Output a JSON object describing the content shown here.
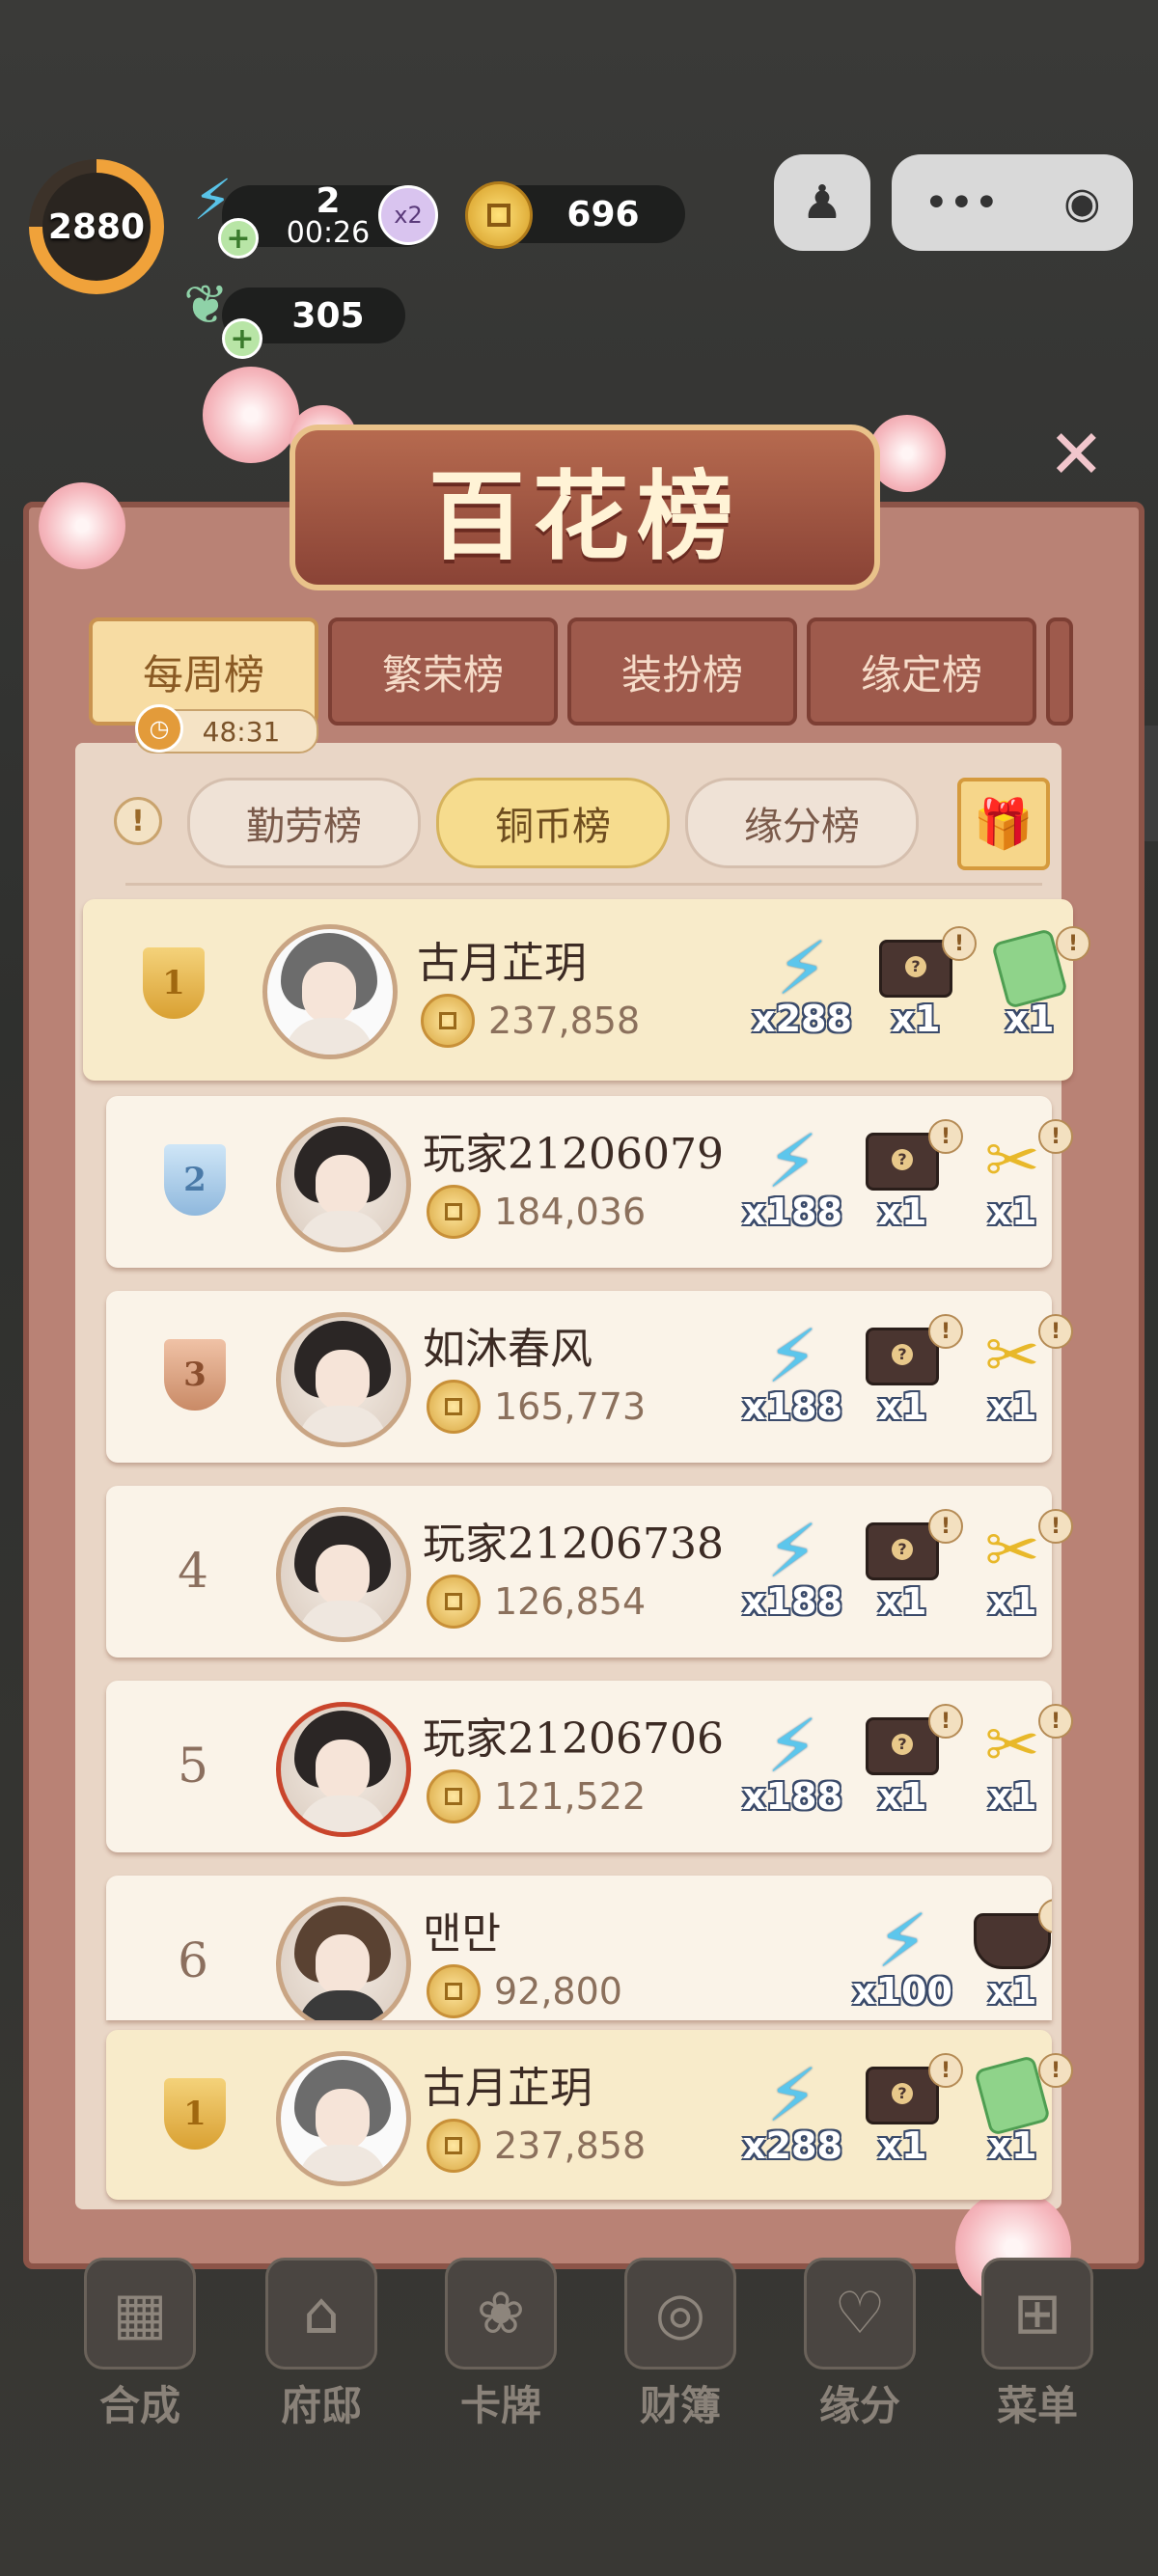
{
  "hud": {
    "level": "2880",
    "energy": "2",
    "energy_timer": "00:26",
    "multiplier": "x2",
    "coins": "696",
    "jade": "305"
  },
  "board": {
    "title": "百花榜",
    "tabs": [
      "每周榜",
      "繁荣榜",
      "装扮榜",
      "缘定榜"
    ],
    "active_tab": "每周榜",
    "tab_timer": "48:31",
    "sub_tabs": [
      "勤劳榜",
      "铜币榜",
      "缘分榜"
    ],
    "active_sub_tab": "铜币榜"
  },
  "rows": [
    {
      "rank": "1",
      "name": "古月芷玥",
      "score": "237,858",
      "r1": "x288",
      "r2": "x1",
      "r3": "x1"
    },
    {
      "rank": "2",
      "name": "玩家21206079",
      "score": "184,036",
      "r1": "x188",
      "r2": "x1",
      "r3": "x1"
    },
    {
      "rank": "3",
      "name": "如沐春风",
      "score": "165,773",
      "r1": "x188",
      "r2": "x1",
      "r3": "x1"
    },
    {
      "rank": "4",
      "name": "玩家21206738",
      "score": "126,854",
      "r1": "x188",
      "r2": "x1",
      "r3": "x1"
    },
    {
      "rank": "5",
      "name": "玩家21206706",
      "score": "121,522",
      "r1": "x188",
      "r2": "x1",
      "r3": "x1"
    },
    {
      "rank": "6",
      "name": "맨만",
      "score": "92,800",
      "r1": "x100",
      "r2": "x1"
    }
  ],
  "my_row": {
    "rank": "1",
    "name": "古月芷玥",
    "score": "237,858",
    "r1": "x288",
    "r2": "x1",
    "r3": "x1"
  },
  "nav": [
    "合成",
    "府邸",
    "卡牌",
    "财簿",
    "缘分",
    "菜单"
  ],
  "colors": {
    "accent": "#f7dca3",
    "frame": "#b98275",
    "row": "#faf3e8",
    "energy": "#5cc6ec"
  }
}
